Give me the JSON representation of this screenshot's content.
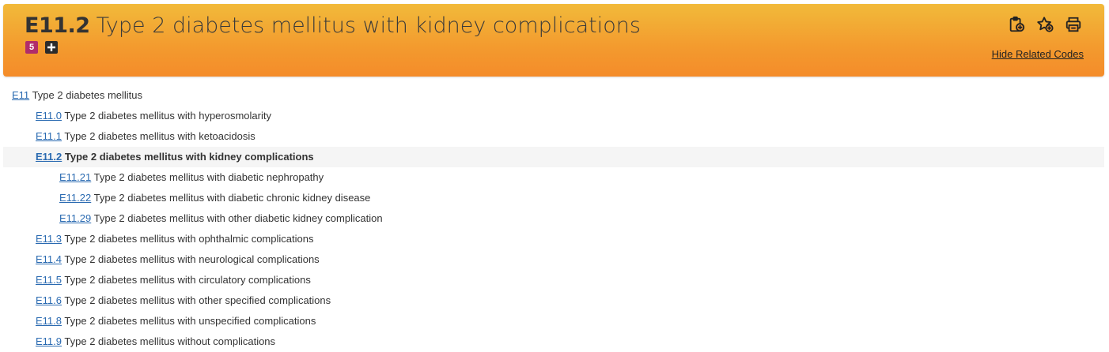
{
  "header": {
    "code": "E11.2",
    "title": "Type 2 diabetes mellitus with kidney complications",
    "badge_count": "5",
    "badge_plus": "+",
    "tools": [
      "add-to-clipboard-icon",
      "add-to-favorites-icon",
      "print-icon"
    ],
    "hide_related_label": "Hide Related Codes",
    "colors": {
      "gradient_top": "#f2ba3a",
      "gradient_bottom": "#f48c2a",
      "link": "#2a6ab1",
      "badge": "#b02c6b"
    }
  },
  "tree": [
    {
      "code": "E11",
      "label": "Type 2 diabetes mellitus",
      "level": 0
    },
    {
      "code": "E11.0",
      "label": "Type 2 diabetes mellitus with hyperosmolarity",
      "level": 1
    },
    {
      "code": "E11.1",
      "label": "Type 2 diabetes mellitus with ketoacidosis",
      "level": 1
    },
    {
      "code": "E11.2",
      "label": "Type 2 diabetes mellitus with kidney complications",
      "level": 1,
      "active": true
    },
    {
      "code": "E11.21",
      "label": "Type 2 diabetes mellitus with diabetic nephropathy",
      "level": 2
    },
    {
      "code": "E11.22",
      "label": "Type 2 diabetes mellitus with diabetic chronic kidney disease",
      "level": 2
    },
    {
      "code": "E11.29",
      "label": "Type 2 diabetes mellitus with other diabetic kidney complication",
      "level": 2
    },
    {
      "code": "E11.3",
      "label": "Type 2 diabetes mellitus with ophthalmic complications",
      "level": 1
    },
    {
      "code": "E11.4",
      "label": "Type 2 diabetes mellitus with neurological complications",
      "level": 1
    },
    {
      "code": "E11.5",
      "label": "Type 2 diabetes mellitus with circulatory complications",
      "level": 1
    },
    {
      "code": "E11.6",
      "label": "Type 2 diabetes mellitus with other specified complications",
      "level": 1
    },
    {
      "code": "E11.8",
      "label": "Type 2 diabetes mellitus with unspecified complications",
      "level": 1
    },
    {
      "code": "E11.9",
      "label": "Type 2 diabetes mellitus without complications",
      "level": 1
    }
  ]
}
